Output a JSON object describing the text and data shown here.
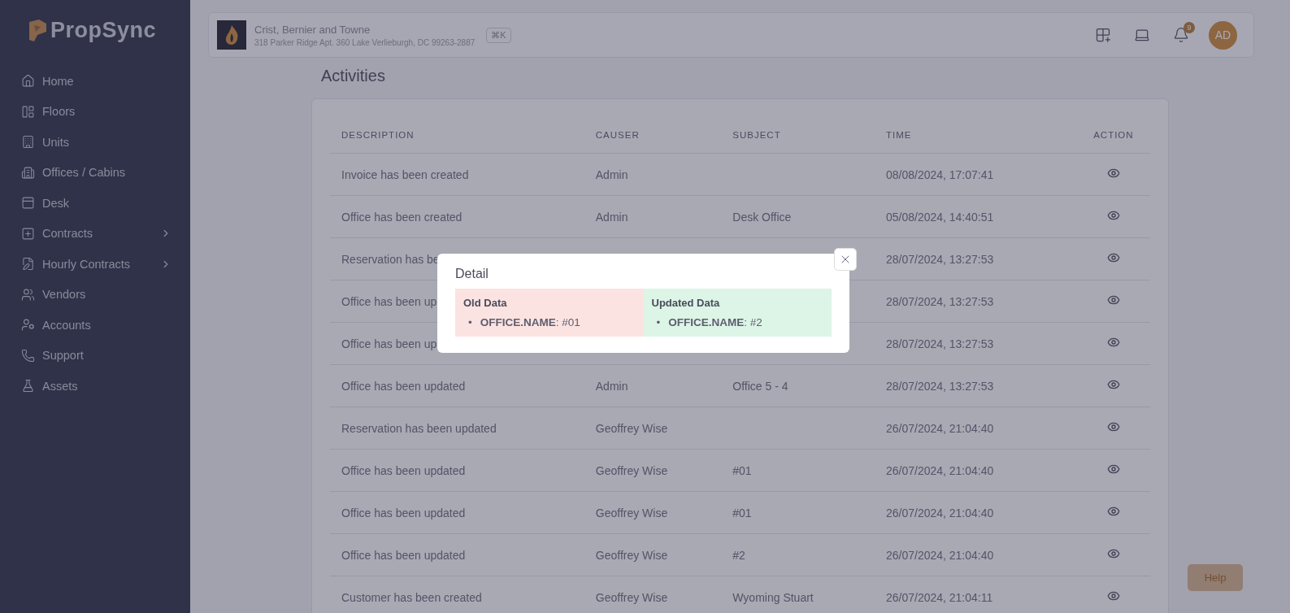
{
  "sidebar": {
    "brand": "PropSync",
    "items": [
      {
        "label": "Home",
        "has_submenu": false
      },
      {
        "label": "Floors",
        "has_submenu": false
      },
      {
        "label": "Units",
        "has_submenu": false
      },
      {
        "label": "Offices / Cabins",
        "has_submenu": false
      },
      {
        "label": "Desk",
        "has_submenu": false
      },
      {
        "label": "Contracts",
        "has_submenu": true
      },
      {
        "label": "Hourly Contracts",
        "has_submenu": true
      },
      {
        "label": "Vendors",
        "has_submenu": false
      },
      {
        "label": "Accounts",
        "has_submenu": false
      },
      {
        "label": "Support",
        "has_submenu": false
      },
      {
        "label": "Assets",
        "has_submenu": false
      }
    ]
  },
  "header": {
    "property_name": "Crist, Bernier and Towne",
    "property_address": "318 Parker Ridge Apt. 360 Lake Verlieburgh, DC 99263-2887",
    "shortcut": "⌘K",
    "notification_count": "9",
    "avatar": "AD"
  },
  "page_title": "Activities",
  "table": {
    "columns": [
      "DESCRIPTION",
      "CAUSER",
      "SUBJECT",
      "TIME",
      "ACTION"
    ],
    "rows": [
      {
        "description": "Invoice has been created",
        "causer": "Admin",
        "time": "08/08/2024, 17:07:41"
      },
      {
        "description": "Office has been created",
        "causer": "Admin",
        "subject": "Desk Office",
        "time": "05/08/2024, 14:40:51"
      },
      {
        "description": "Reservation has be",
        "time": "28/07/2024, 13:27:53"
      },
      {
        "description": "Office has been up",
        "time": "28/07/2024, 13:27:53"
      },
      {
        "description": "Office has been up",
        "time": "28/07/2024, 13:27:53"
      },
      {
        "description": "Office has been updated",
        "causer": "Admin",
        "subject": "Office 5 - 4",
        "time": "28/07/2024, 13:27:53"
      },
      {
        "description": "Reservation has been updated",
        "causer": "Geoffrey Wise",
        "time": "26/07/2024, 21:04:40"
      },
      {
        "description": "Office has been updated",
        "causer": "Geoffrey Wise",
        "subject": "#01",
        "time": "26/07/2024, 21:04:40"
      },
      {
        "description": "Office has been updated",
        "causer": "Geoffrey Wise",
        "subject": "#01",
        "time": "26/07/2024, 21:04:40"
      },
      {
        "description": "Office has been updated",
        "causer": "Geoffrey Wise",
        "subject": "#2",
        "time": "26/07/2024, 21:04:40"
      },
      {
        "description": "Customer has been created",
        "causer": "Geoffrey Wise",
        "subject": "Wyoming Stuart",
        "time": "26/07/2024, 21:04:11"
      }
    ]
  },
  "modal": {
    "title": "Detail",
    "panels": [
      {
        "kind": "old",
        "heading": "Old Data",
        "items": [
          {
            "bullet": "•",
            "text": "**OFFICE.NAME**: #01"
          }
        ]
      },
      {
        "kind": "new",
        "heading": "Updated Data",
        "items": [
          {
            "bullet": "•",
            "text": "**OFFICE.NAME**: #2"
          }
        ]
      }
    ]
  },
  "help_button": "Help"
}
